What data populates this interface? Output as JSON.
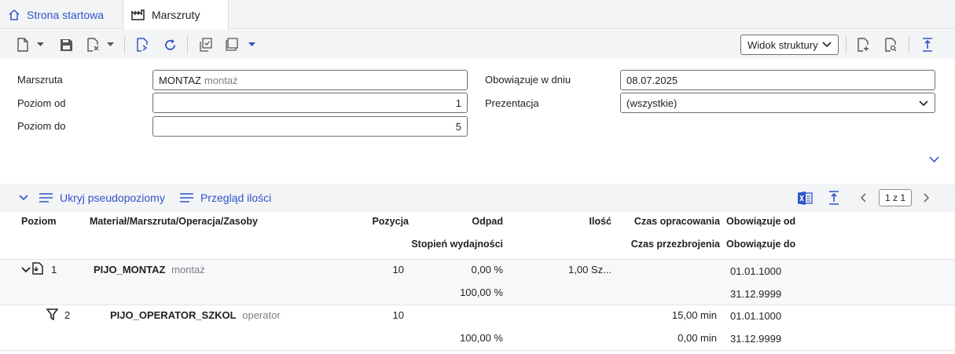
{
  "tabs": {
    "home_label": "Strona startowa",
    "active_label": "Marszruty"
  },
  "toolbar": {
    "view_select_value": "Widok struktury"
  },
  "form": {
    "marszruta_label": "Marszruta",
    "marszruta_value": "MONTAZ",
    "marszruta_desc": "montaż",
    "poziom_od_label": "Poziom od",
    "poziom_od_value": "1",
    "poziom_do_label": "Poziom do",
    "poziom_do_value": "5",
    "obowiazuje_label": "Obowiązuje w dniu",
    "obowiazuje_value": "08.07.2025",
    "prezentacja_label": "Prezentacja",
    "prezentacja_value": "(wszystkie)"
  },
  "grid_toolbar": {
    "hide_pseudo_label": "Ukryj pseudopoziomy",
    "qty_overview_label": "Przegląd ilości",
    "pager": "1 z 1"
  },
  "grid": {
    "headers": {
      "poziom": "Poziom",
      "material": "Materiał/Marszruta/Operacja/Zasoby",
      "pozycja": "Pozycja",
      "odpad": "Odpad",
      "ilosc": "Ilość",
      "czas_opracowania": "Czas opracowania",
      "obowiazuje_od": "Obowiązuje od",
      "stopien": "Stopień wydajności",
      "czas_przezbrojenia": "Czas przezbrojenia",
      "obowiazuje_do": "Obowiązuje do"
    },
    "rows": [
      {
        "level": "1",
        "name": "PIJO_MONTAZ",
        "desc": "montaż",
        "pozycja": "10",
        "odpad": "0,00 %",
        "ilosc": "1,00 Sz...",
        "czas_opracowania": "",
        "obowiazuje_od": "01.01.1000",
        "stopien": "100,00 %",
        "czas_przezbrojenia": "",
        "obowiazuje_do": "31.12.9999"
      },
      {
        "level": "2",
        "name": "PIJO_OPERATOR_SZKOL",
        "desc": "operator",
        "pozycja": "10",
        "odpad": "",
        "ilosc": "",
        "czas_opracowania": "15,00 min",
        "obowiazuje_od": "01.01.1000",
        "stopien": "100,00 %",
        "czas_przezbrojenia": "0,00 min",
        "obowiazuje_do": "31.12.9999"
      }
    ]
  }
}
